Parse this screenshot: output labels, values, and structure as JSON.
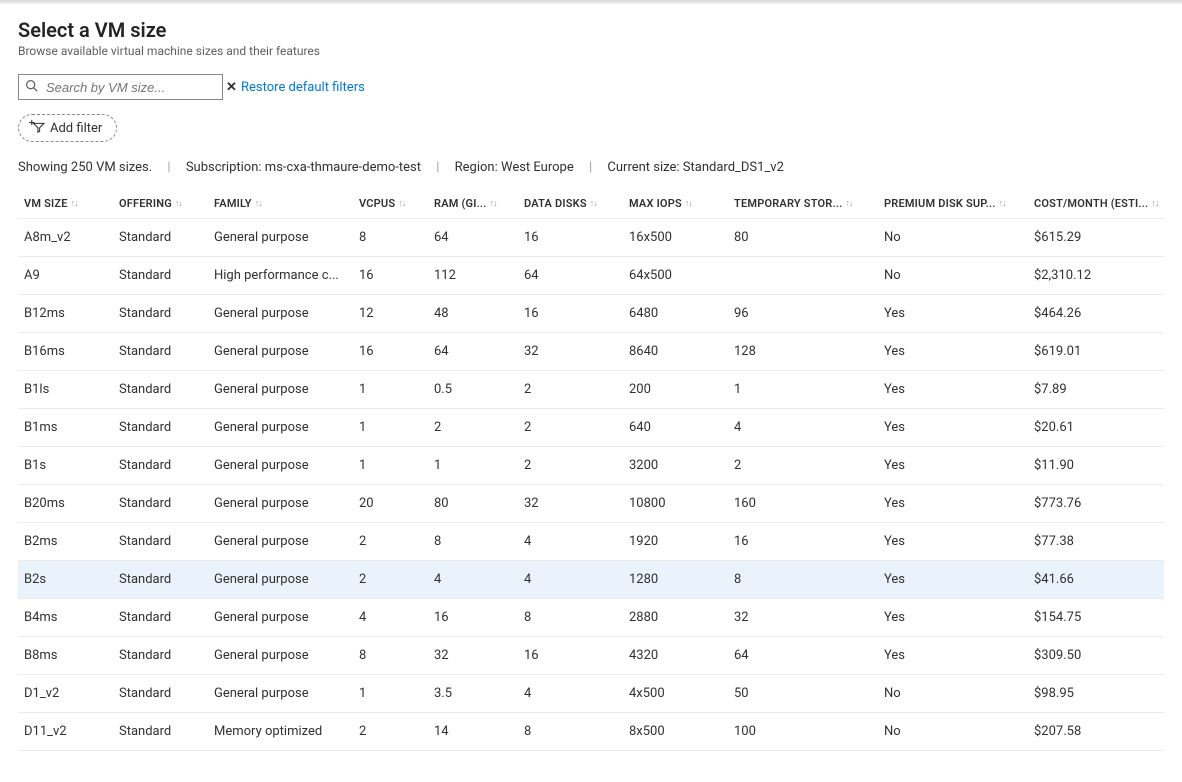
{
  "header": {
    "title": "Select a VM size",
    "subtitle": "Browse available virtual machine sizes and their features"
  },
  "search": {
    "placeholder": "Search by VM size..."
  },
  "restore_filters_label": "Restore default filters",
  "add_filter_label": "Add filter",
  "meta": {
    "showing": "Showing 250 VM sizes.",
    "subscription_label": "Subscription:",
    "subscription_value": "ms-cxa-thmaure-demo-test",
    "region_label": "Region:",
    "region_value": "West Europe",
    "current_size_label": "Current size:",
    "current_size_value": "Standard_DS1_v2"
  },
  "columns": [
    "VM SIZE",
    "OFFERING",
    "FAMILY",
    "VCPUS",
    "RAM (GI...",
    "DATA DISKS",
    "MAX IOPS",
    "TEMPORARY STOR...",
    "PREMIUM DISK SUP...",
    "COST/MONTH (ESTI..."
  ],
  "rows": [
    {
      "vm_size": "A8m_v2",
      "offering": "Standard",
      "family": "General purpose",
      "vcpus": "8",
      "ram": "64",
      "data_disks": "16",
      "max_iops": "16x500",
      "temp_storage": "80",
      "premium": "No",
      "cost": "$615.29",
      "selected": false
    },
    {
      "vm_size": "A9",
      "offering": "Standard",
      "family": "High performance c...",
      "vcpus": "16",
      "ram": "112",
      "data_disks": "64",
      "max_iops": "64x500",
      "temp_storage": "",
      "premium": "No",
      "cost": "$2,310.12",
      "selected": false
    },
    {
      "vm_size": "B12ms",
      "offering": "Standard",
      "family": "General purpose",
      "vcpus": "12",
      "ram": "48",
      "data_disks": "16",
      "max_iops": "6480",
      "temp_storage": "96",
      "premium": "Yes",
      "cost": "$464.26",
      "selected": false
    },
    {
      "vm_size": "B16ms",
      "offering": "Standard",
      "family": "General purpose",
      "vcpus": "16",
      "ram": "64",
      "data_disks": "32",
      "max_iops": "8640",
      "temp_storage": "128",
      "premium": "Yes",
      "cost": "$619.01",
      "selected": false
    },
    {
      "vm_size": "B1ls",
      "offering": "Standard",
      "family": "General purpose",
      "vcpus": "1",
      "ram": "0.5",
      "data_disks": "2",
      "max_iops": "200",
      "temp_storage": "1",
      "premium": "Yes",
      "cost": "$7.89",
      "selected": false
    },
    {
      "vm_size": "B1ms",
      "offering": "Standard",
      "family": "General purpose",
      "vcpus": "1",
      "ram": "2",
      "data_disks": "2",
      "max_iops": "640",
      "temp_storage": "4",
      "premium": "Yes",
      "cost": "$20.61",
      "selected": false
    },
    {
      "vm_size": "B1s",
      "offering": "Standard",
      "family": "General purpose",
      "vcpus": "1",
      "ram": "1",
      "data_disks": "2",
      "max_iops": "3200",
      "temp_storage": "2",
      "premium": "Yes",
      "cost": "$11.90",
      "selected": false
    },
    {
      "vm_size": "B20ms",
      "offering": "Standard",
      "family": "General purpose",
      "vcpus": "20",
      "ram": "80",
      "data_disks": "32",
      "max_iops": "10800",
      "temp_storage": "160",
      "premium": "Yes",
      "cost": "$773.76",
      "selected": false
    },
    {
      "vm_size": "B2ms",
      "offering": "Standard",
      "family": "General purpose",
      "vcpus": "2",
      "ram": "8",
      "data_disks": "4",
      "max_iops": "1920",
      "temp_storage": "16",
      "premium": "Yes",
      "cost": "$77.38",
      "selected": false
    },
    {
      "vm_size": "B2s",
      "offering": "Standard",
      "family": "General purpose",
      "vcpus": "2",
      "ram": "4",
      "data_disks": "4",
      "max_iops": "1280",
      "temp_storage": "8",
      "premium": "Yes",
      "cost": "$41.66",
      "selected": true
    },
    {
      "vm_size": "B4ms",
      "offering": "Standard",
      "family": "General purpose",
      "vcpus": "4",
      "ram": "16",
      "data_disks": "8",
      "max_iops": "2880",
      "temp_storage": "32",
      "premium": "Yes",
      "cost": "$154.75",
      "selected": false
    },
    {
      "vm_size": "B8ms",
      "offering": "Standard",
      "family": "General purpose",
      "vcpus": "8",
      "ram": "32",
      "data_disks": "16",
      "max_iops": "4320",
      "temp_storage": "64",
      "premium": "Yes",
      "cost": "$309.50",
      "selected": false
    },
    {
      "vm_size": "D1_v2",
      "offering": "Standard",
      "family": "General purpose",
      "vcpus": "1",
      "ram": "3.5",
      "data_disks": "4",
      "max_iops": "4x500",
      "temp_storage": "50",
      "premium": "No",
      "cost": "$98.95",
      "selected": false
    },
    {
      "vm_size": "D11_v2",
      "offering": "Standard",
      "family": "Memory optimized",
      "vcpus": "2",
      "ram": "14",
      "data_disks": "8",
      "max_iops": "8x500",
      "temp_storage": "100",
      "premium": "No",
      "cost": "$207.58",
      "selected": false
    }
  ]
}
